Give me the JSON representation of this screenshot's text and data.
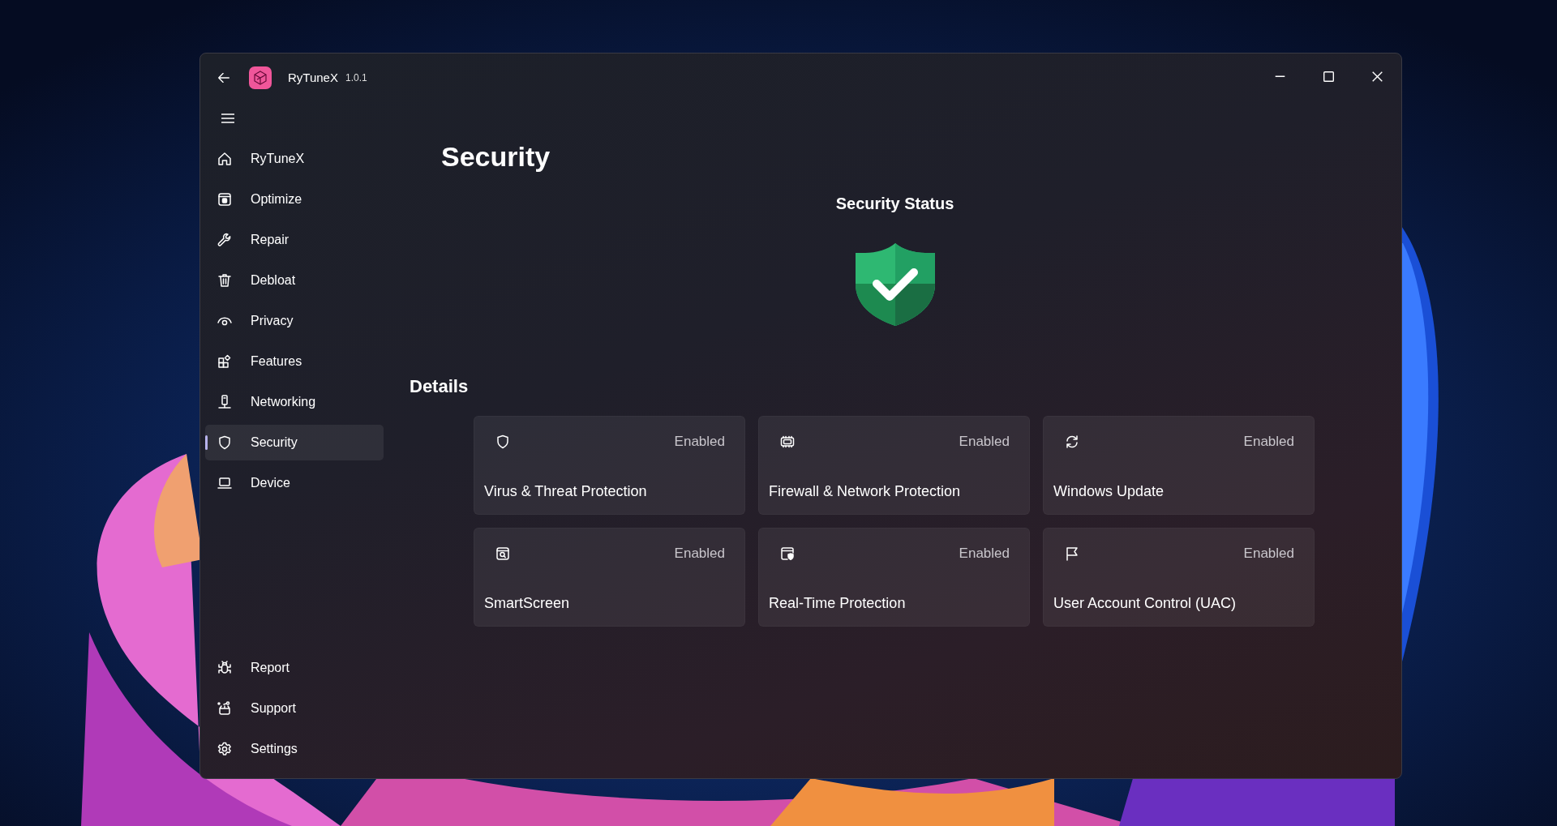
{
  "window": {
    "app_name": "RyTuneX",
    "version": "1.0.1"
  },
  "sidebar": {
    "items": [
      {
        "label": "RyTuneX",
        "kind": "home",
        "selected": false
      },
      {
        "label": "Optimize",
        "kind": "optimize",
        "selected": false
      },
      {
        "label": "Repair",
        "kind": "wrench",
        "selected": false
      },
      {
        "label": "Debloat",
        "kind": "trash",
        "selected": false
      },
      {
        "label": "Privacy",
        "kind": "eye",
        "selected": false
      },
      {
        "label": "Features",
        "kind": "apps",
        "selected": false
      },
      {
        "label": "Networking",
        "kind": "network",
        "selected": false
      },
      {
        "label": "Security",
        "kind": "shield",
        "selected": true
      },
      {
        "label": "Device",
        "kind": "laptop",
        "selected": false
      }
    ],
    "footer_items": [
      {
        "label": "Report",
        "kind": "bug",
        "selected": false
      },
      {
        "label": "Support",
        "kind": "gift",
        "selected": false
      },
      {
        "label": "Settings",
        "kind": "gear",
        "selected": false
      }
    ]
  },
  "page": {
    "title": "Security",
    "status_heading": "Security Status",
    "details_heading": "Details",
    "cards": [
      {
        "kind": "shield",
        "status": "Enabled",
        "label": "Virus & Threat Protection"
      },
      {
        "kind": "chip",
        "status": "Enabled",
        "label": "Firewall & Network Protection"
      },
      {
        "kind": "sync",
        "status": "Enabled",
        "label": "Windows Update"
      },
      {
        "kind": "browser-search",
        "status": "Enabled",
        "label": "SmartScreen"
      },
      {
        "kind": "window-shield",
        "status": "Enabled",
        "label": "Real-Time Protection"
      },
      {
        "kind": "flag",
        "status": "Enabled",
        "label": "User Account Control (UAC)"
      }
    ]
  }
}
